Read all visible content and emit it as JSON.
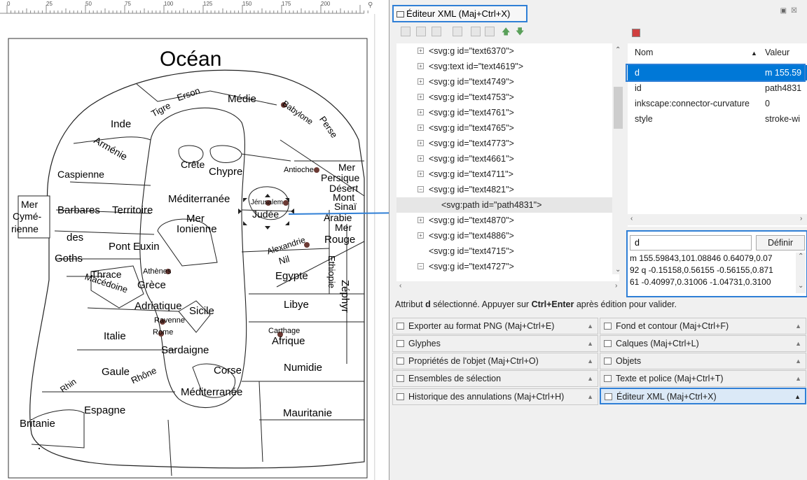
{
  "ruler": {
    "labels": [
      "0",
      "25",
      "50",
      "75",
      "100",
      "125",
      "150",
      "175",
      "200"
    ]
  },
  "map": {
    "labels": {
      "ocean": "Océan",
      "media": "Médie",
      "tigre": "Tigre",
      "erson": "Erson",
      "inde": "Inde",
      "babylone": "Babylone",
      "perse": "Perse",
      "armenie": "Arménie",
      "crete": "Crête",
      "chypre": "Chypre",
      "antioche": "Antioche",
      "mer_persique_1": "Mer",
      "mer_persique_2": "Persique",
      "caspienne": "Caspienne",
      "desert": "Désert",
      "mont_sinai_1": "Mont",
      "mont_sinai_2": "Sinaï",
      "mediterranee_top": "Méditerranée",
      "jerusalem": "Jérusalem",
      "judee": "Judée",
      "arabie": "Arabie",
      "mer_cym_1": "Mer",
      "mer_cym_2": "Cymé-",
      "mer_cym_3": "rienne",
      "barbares": "Barbares",
      "territoire": "Territoire",
      "mer_ion_1": "Mer",
      "mer_ion_2": "Ionienne",
      "mer_rouge_1": "Mer",
      "mer_rouge_2": "Rouge",
      "des": "des",
      "goths": "Goths",
      "pont_euxin": "Pont Euxin",
      "alexandrie": "Alexandrie",
      "nil": "Nil",
      "zephyr": "Zéphyr",
      "thrace": "Thrace",
      "macedoine": "Macédoine",
      "athenes": "Athènes",
      "grece": "Grèce",
      "egypte": "Egypte",
      "ethiopie": "Ethiopie",
      "adriatique": "Adriatique",
      "sicile": "Sicile",
      "libye": "Libye",
      "ravenne": "Ravenne",
      "italie": "Italie",
      "rome": "Rome",
      "carthage": "Carthage",
      "afrique": "Afrique",
      "sardaigne": "Sardaigne",
      "gaule": "Gaule",
      "rhone": "Rhône",
      "rhin": "Rhin",
      "corse": "Corse",
      "numidie": "Numidie",
      "mediterranee_bottom": "Méditerranée",
      "espagne": "Espagne",
      "mauritanie": "Mauritanie",
      "britanie": "Britanie"
    }
  },
  "dock": {
    "title": "Éditeur XML (Maj+Ctrl+X)",
    "tree": [
      {
        "label": "<svg:g id=\"text6370\">",
        "expander": "+",
        "indent": 0
      },
      {
        "label": "<svg:text id=\"text4619\">",
        "expander": "+",
        "indent": 0
      },
      {
        "label": "<svg:g id=\"text4749\">",
        "expander": "+",
        "indent": 0
      },
      {
        "label": "<svg:g id=\"text4753\">",
        "expander": "+",
        "indent": 0
      },
      {
        "label": "<svg:g id=\"text4761\">",
        "expander": "+",
        "indent": 0
      },
      {
        "label": "<svg:g id=\"text4765\">",
        "expander": "+",
        "indent": 0
      },
      {
        "label": "<svg:g id=\"text4773\">",
        "expander": "+",
        "indent": 0
      },
      {
        "label": "<svg:g id=\"text4661\">",
        "expander": "+",
        "indent": 0
      },
      {
        "label": "<svg:g id=\"text4711\">",
        "expander": "+",
        "indent": 0
      },
      {
        "label": "<svg:g id=\"text4821\">",
        "expander": "−",
        "indent": 0
      },
      {
        "label": "<svg:path id=\"path4831\">",
        "expander": "",
        "indent": 1
      },
      {
        "label": "<svg:g id=\"text4870\">",
        "expander": "+",
        "indent": 0
      },
      {
        "label": "<svg:g id=\"text4886\">",
        "expander": "+",
        "indent": 0
      },
      {
        "label": "<svg:g id=\"text4715\">",
        "expander": "",
        "indent": 0
      },
      {
        "label": "<svg:g id=\"text4727\">",
        "expander": "−",
        "indent": 0
      }
    ],
    "attributes": {
      "header_name": "Nom",
      "header_value": "Valeur",
      "rows": [
        {
          "name": "d",
          "value": "m 155.59"
        },
        {
          "name": "id",
          "value": "path4831"
        },
        {
          "name": "inkscape:connector-curvature",
          "value": "0"
        },
        {
          "name": "style",
          "value": "stroke-wi"
        }
      ]
    },
    "editor": {
      "attr_name": "d",
      "define_label": "Définir",
      "value_text": "m 155.59843,101.08846 0.64079,0.07\n92 q -0.15158,0.56155 -0.56155,0.871\n61 -0.40997,0.31006 -1.04731,0.3100"
    },
    "hint": {
      "part1": "Attribut ",
      "bold1": "d",
      "part2": " sélectionné. Appuyer sur ",
      "bold2": "Ctrl+Enter",
      "part3": " après édition pour valider."
    },
    "panels_left": [
      "Exporter au format PNG (Maj+Ctrl+E)",
      "Glyphes",
      "Propriétés de l'objet (Maj+Ctrl+O)",
      "Ensembles de sélection",
      "Historique des annulations (Maj+Ctrl+H)"
    ],
    "panels_right": [
      "Fond et contour (Maj+Ctrl+F)",
      "Calques (Maj+Ctrl+L)",
      "Objets",
      "Texte et police (Maj+Ctrl+T)",
      "Éditeur XML (Maj+Ctrl+X)"
    ]
  },
  "colors": {
    "selection_blue": "#0078d7",
    "highlight_outline": "#2f7fd6",
    "city_dot": "#6b3a34",
    "panel_bg": "#f0f0f0"
  }
}
